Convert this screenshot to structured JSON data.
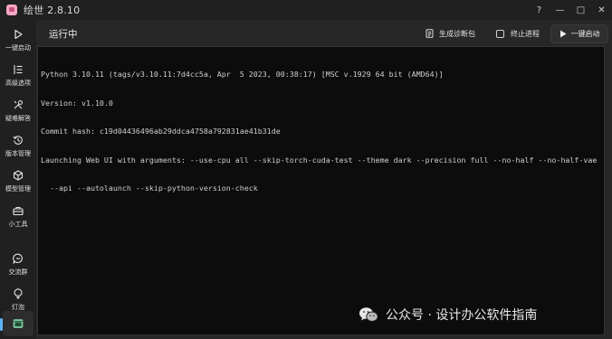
{
  "window": {
    "title": "绘世 2.8.10",
    "controls": {
      "help": "?",
      "minimize": "—",
      "maximize": "□",
      "close": "✕"
    }
  },
  "sidebar": {
    "items": [
      {
        "label": "一键启动",
        "icon": "play-icon"
      },
      {
        "label": "高级选项",
        "icon": "sliders-list-icon"
      },
      {
        "label": "疑难解答",
        "icon": "tools-icon"
      },
      {
        "label": "版本管理",
        "icon": "history-icon"
      },
      {
        "label": "模型管理",
        "icon": "cube-icon"
      },
      {
        "label": "小工具",
        "icon": "toolbox-icon"
      },
      {
        "label": "交流群",
        "icon": "chat-icon"
      },
      {
        "label": "灯泡",
        "icon": "bulb-icon"
      }
    ],
    "bottom_icon": "console-icon",
    "accent_color": "#5fb3ff"
  },
  "header": {
    "status": "运行中",
    "actions": {
      "diagnostic": "生成诊断包",
      "terminate": "终止进程",
      "launch": "一键启动"
    }
  },
  "console": {
    "lines": [
      "Python 3.10.11 (tags/v3.10.11:7d4cc5a, Apr  5 2023, 00:38:17) [MSC v.1929 64 bit (AMD64)]",
      "Version: v1.10.0",
      "Commit hash: c19d04436496ab29ddca4758a792831ae41b31de",
      "Launching Web UI with arguments: --use-cpu all --skip-torch-cuda-test --theme dark --precision full --no-half --no-half-vae",
      "  --api --autolaunch --skip-python-version-check"
    ]
  },
  "watermark": {
    "text": "公众号 · 设计办公软件指南"
  }
}
